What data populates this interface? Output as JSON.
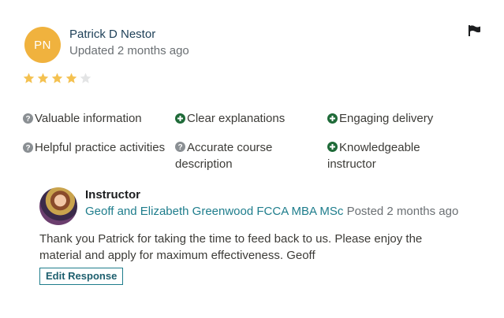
{
  "review": {
    "avatar_initials": "PN",
    "avatar_color": "#f0b23e",
    "reviewer_name": "Patrick D Nestor",
    "updated_text": "Updated 2 months ago",
    "rating": 4,
    "rating_max": 5,
    "star_color": "#f4c150",
    "flag_icon": "flag-icon",
    "attributes": [
      {
        "icon": "question-circle-icon",
        "label": "Valuable information"
      },
      {
        "icon": "plus-circle-icon",
        "label": "Clear explanations"
      },
      {
        "icon": "plus-circle-icon",
        "label": "Engaging delivery"
      },
      {
        "icon": "question-circle-icon",
        "label": "Helpful practice activities"
      },
      {
        "icon": "question-circle-icon",
        "label": "Accurate course description"
      },
      {
        "icon": "plus-circle-icon",
        "label": "Knowledgeable instructor"
      }
    ]
  },
  "response": {
    "label": "Instructor",
    "instructor_name": "Geoff and Elizabeth Greenwood FCCA MBA MSc",
    "posted_text": "Posted 2 months ago",
    "text": "Thank you Patrick for taking the time to feed back to us. Please enjoy the material and apply for maximum effectiveness. Geoff",
    "edit_label": "Edit Response",
    "accent_color": "#1e7d8c"
  }
}
